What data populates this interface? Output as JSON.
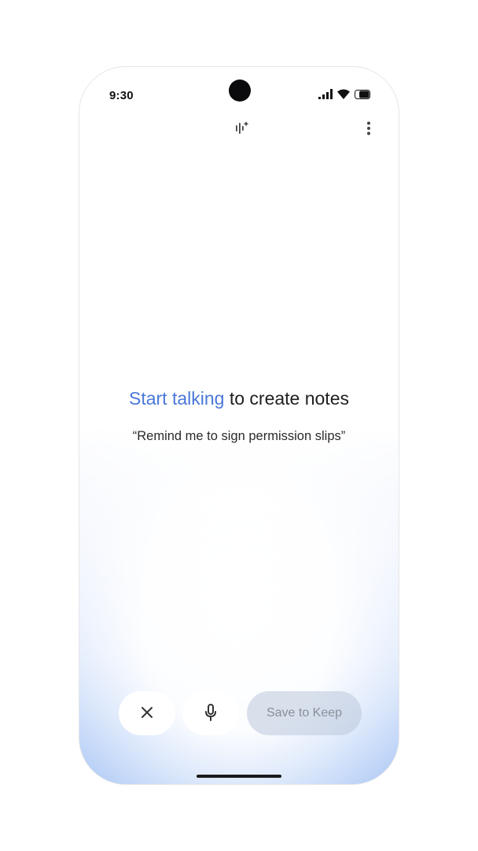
{
  "status_bar": {
    "time": "9:30"
  },
  "top_bar": {
    "transcribe_icon": "audio-sparkle-icon",
    "menu_icon": "more-vert-icon"
  },
  "main": {
    "headline_accent": "Start talking",
    "headline_rest": " to create notes",
    "example_prompt": "“Remind me to sign permission slips”"
  },
  "actions": {
    "cancel_icon": "close-icon",
    "mic_icon": "microphone-icon",
    "save_label": "Save to Keep"
  },
  "colors": {
    "accent": "#4a78d8",
    "gradient_bottom": "#a9c6f5",
    "save_button_bg": "#c8d4e8"
  }
}
